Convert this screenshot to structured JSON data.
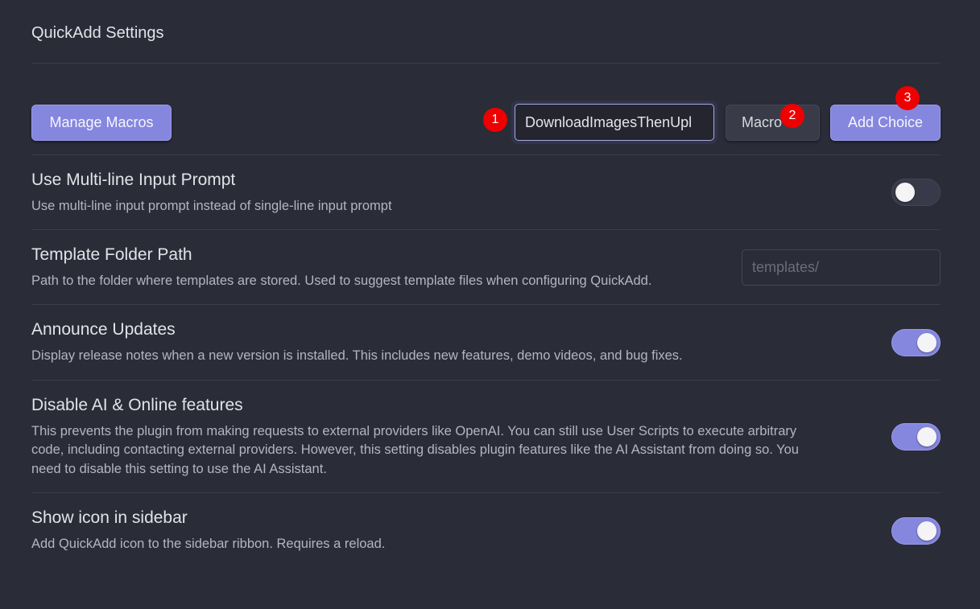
{
  "header": {
    "title": "QuickAdd Settings"
  },
  "toolbar": {
    "manage_macros_label": "Manage Macros",
    "choice_name_value": "DownloadImagesThenUpl",
    "choice_type_label": "Macro",
    "add_choice_label": "Add Choice"
  },
  "badges": [
    "1",
    "2",
    "3"
  ],
  "settings": [
    {
      "name": "Use Multi-line Input Prompt",
      "description": "Use multi-line input prompt instead of single-line input prompt",
      "control": "toggle",
      "enabled": false
    },
    {
      "name": "Template Folder Path",
      "description": "Path to the folder where templates are stored. Used to suggest template files when configuring QuickAdd.",
      "control": "text",
      "placeholder": "templates/"
    },
    {
      "name": "Announce Updates",
      "description": "Display release notes when a new version is installed. This includes new features, demo videos, and bug fixes.",
      "control": "toggle",
      "enabled": true
    },
    {
      "name": "Disable AI & Online features",
      "description_lines": [
        "This prevents the plugin from making requests to external providers like OpenAI. You can still use User Scripts to execute arbitrary",
        "code, including contacting external providers. However, this setting disables plugin features like the AI Assistant from doing so. You",
        "need to disable this setting to use the AI Assistant."
      ],
      "control": "toggle",
      "enabled": true
    },
    {
      "name": "Show icon in sidebar",
      "description": "Add QuickAdd icon to the sidebar ribbon. Requires a reload.",
      "control": "toggle",
      "enabled": true
    }
  ],
  "colors": {
    "background": "#2a2c38",
    "accent": "#8586de",
    "badge": "#ef0000"
  }
}
